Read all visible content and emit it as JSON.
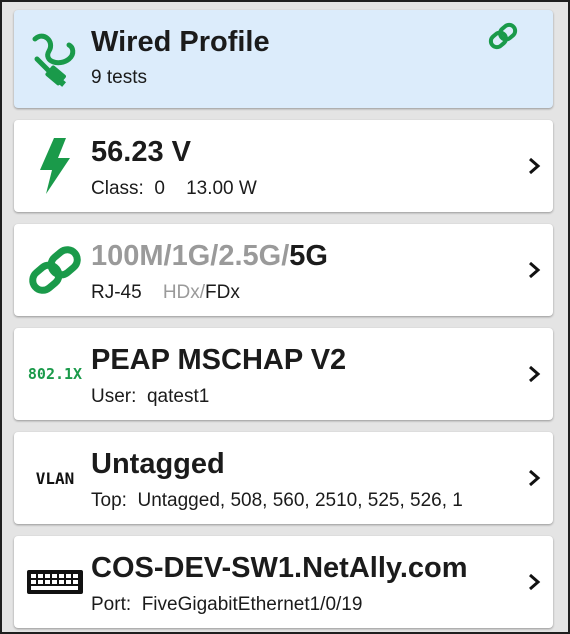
{
  "colors": {
    "accent_green": "#1a9a4a",
    "profile_bg": "#dcecfb"
  },
  "profile": {
    "title": "Wired Profile",
    "subtitle": "9 tests",
    "icon": "ethernet-cable-icon",
    "link_icon": "link-icon"
  },
  "poe": {
    "title": "56.23 V",
    "class_label": "Class:",
    "class_value": "0",
    "power": "13.00 W",
    "icon": "lightning-bolt-icon"
  },
  "link": {
    "speeds_inactive": "100M/1G/2.5G/",
    "speed_active": "5G",
    "port_type": "RJ-45",
    "duplex_inactive": "HDx/",
    "duplex_active": "FDx",
    "icon": "link-chain-icon"
  },
  "auth": {
    "badge": "802.1X",
    "title": "PEAP MSCHAP V2",
    "user_label": "User:",
    "user_value": "qatest1"
  },
  "vlan": {
    "badge": "VLAN",
    "title": "Untagged",
    "top_label": "Top:",
    "top_value": "Untagged, 508, 560, 2510, 525, 526, 1"
  },
  "switch": {
    "title": "COS-DEV-SW1.NetAlly.com",
    "port_label": "Port:",
    "port_value": "FiveGigabitEthernet1/0/19",
    "icon": "switch-icon"
  }
}
